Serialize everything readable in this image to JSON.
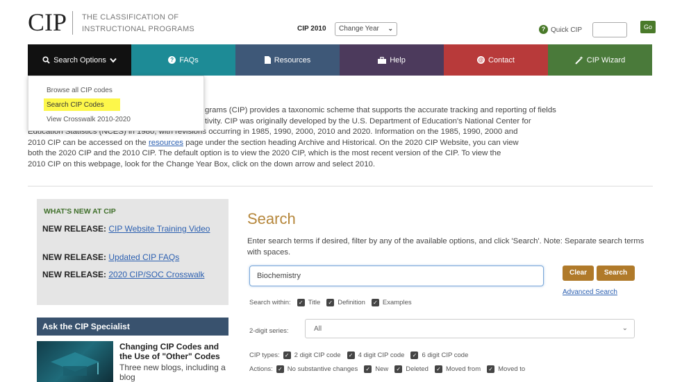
{
  "header": {
    "logo_text": "CIP",
    "logo_line1": "THE CLASSIFICATION OF",
    "logo_line2": "INSTRUCTIONAL PROGRAMS",
    "year_label": "CIP 2010",
    "year_select_value": "Change Year",
    "quick_cip_label": "Quick CIP",
    "go_label": "Go"
  },
  "nav": {
    "items": [
      {
        "label": "Search Options",
        "icon": "search-icon",
        "color": "#111111"
      },
      {
        "label": "FAQs",
        "icon": "question-icon",
        "color": "#1d8b96"
      },
      {
        "label": "Resources",
        "icon": "document-icon",
        "color": "#3e5878"
      },
      {
        "label": "Help",
        "icon": "toolbox-icon",
        "color": "#4c3a5c"
      },
      {
        "label": "Contact",
        "icon": "at-icon",
        "color": "#b83a3a"
      },
      {
        "label": "CIP Wizard",
        "icon": "wand-icon",
        "color": "#4a7a3a"
      }
    ]
  },
  "dropdown": {
    "items": [
      "Browse all CIP codes",
      "Search CIP Codes",
      "View Crosswalk 2010-2020"
    ]
  },
  "intro": {
    "line1": "grams (CIP) provides a taxonomic scheme that supports the accurate tracking and reporting of fields",
    "line2": "tivity. CIP was originally developed by the U.S. Department of Education's National Center for",
    "line3": "Education Statistics (NCES) in 1980, with revisions occurring in 1985, 1990, 2000, 2010 and 2020. Information on the 1985, 1990, 2000 and",
    "line4a": "2010 CIP can be accessed on the ",
    "line4_link": "resources",
    "line4b": " page under the section heading Archive and Historical. On the 2020 CIP Website, you can view",
    "line5": "both the 2020 CIP and the 2010 CIP. The default option is to view the 2020 CIP, which is the most recent version of the CIP. To view the",
    "line6": "2010 CIP on this webpage, look for the Change Year Box, click on the down arrow and select 2010."
  },
  "whats_new": {
    "title": "WHAT'S NEW AT CIP",
    "items": [
      {
        "prefix": "NEW RELEASE:",
        "link": "CIP Website Training Video"
      },
      {
        "prefix": "NEW RELEASE:",
        "link": "Updated CIP FAQs"
      },
      {
        "prefix": "NEW RELEASE:",
        "link": "2020 CIP/SOC Crosswalk"
      }
    ]
  },
  "ask": {
    "title": "Ask the CIP Specialist",
    "blog_title": "Changing CIP Codes and the Use of \"Other\" Codes",
    "blog_text": "Three new blogs, including a blog"
  },
  "search": {
    "title": "Search",
    "description": "Enter search terms if desired, filter by any of the available options, and click 'Search'. Note: Separate search terms with spaces.",
    "input_value": "Biochemistry",
    "clear_label": "Clear",
    "search_label": "Search",
    "advanced_label": "Advanced Search",
    "within_label": "Search within:",
    "within_options": [
      "Title",
      "Definition",
      "Examples"
    ],
    "series_label": "2-digit series:",
    "series_value": "All",
    "types_label": "CIP types:",
    "types_options": [
      "2 digit CIP code",
      "4 digit CIP code",
      "6 digit CIP code"
    ],
    "actions_label": "Actions:",
    "actions_options": [
      "No substantive changes",
      "New",
      "Deleted",
      "Moved from",
      "Moved to"
    ]
  }
}
